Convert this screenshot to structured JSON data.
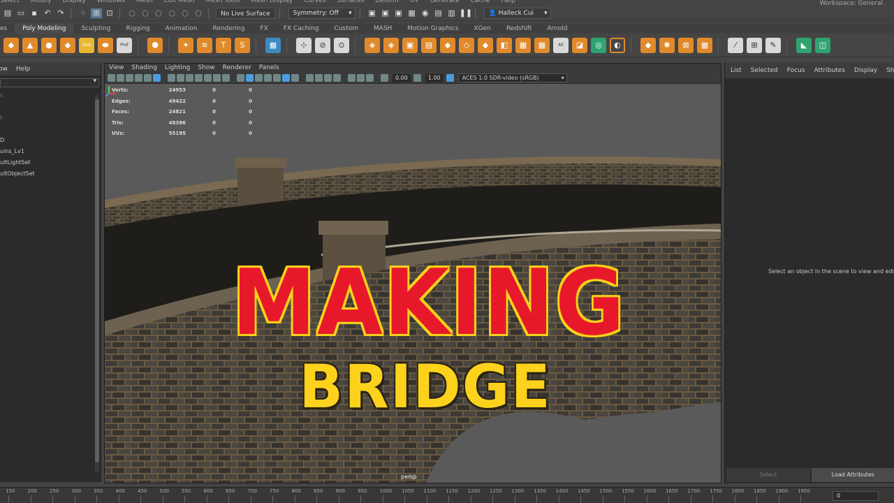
{
  "app": {
    "menubar_items": [
      "Select",
      "Modify",
      "Display",
      "Windows",
      "Mesh",
      "Edit Mesh",
      "Mesh Tools",
      "Mesh Display",
      "Curves",
      "Surfaces",
      "Deform",
      "UV",
      "Generate",
      "Cache",
      "Help"
    ],
    "workspace_label": "Workspace: General"
  },
  "status_line": {
    "live_surface": "No Live Surface",
    "symmetry": "Symmetry: Off",
    "user": "Halleck Cui"
  },
  "shelf": {
    "tabs": [
      "es",
      "Poly Modeling",
      "Sculpting",
      "Rigging",
      "Animation",
      "Rendering",
      "FX",
      "FX Caching",
      "Custom",
      "MASH",
      "Motion Graphics",
      "XGen",
      "Redshift",
      "Arnold"
    ],
    "active_tab": "Poly Modeling",
    "icon_labels": {
      "sele": "Sele",
      "pref": "Pref",
      "all": "All"
    }
  },
  "outliner": {
    "menu": [
      "ow",
      "Help"
    ],
    "items": [
      "s",
      "",
      "t",
      "",
      "D",
      "uins_Lv1",
      "ultLightSet",
      "ultObjectSet"
    ]
  },
  "viewport": {
    "menu": [
      "View",
      "Shading",
      "Lighting",
      "Show",
      "Renderer",
      "Panels"
    ],
    "exposure": "0.00",
    "gamma": "1.00",
    "color_space": "ACES 1.0 SDR-video (sRGB)",
    "camera": "persp",
    "hud": [
      {
        "label": "Verts:",
        "v1": "24953",
        "v2": "0",
        "v3": "0"
      },
      {
        "label": "Edges:",
        "v1": "49422",
        "v2": "0",
        "v3": "0"
      },
      {
        "label": "Faces:",
        "v1": "24821",
        "v2": "0",
        "v3": "0"
      },
      {
        "label": "Tris:",
        "v1": "48386",
        "v2": "0",
        "v3": "0"
      },
      {
        "label": "UVs:",
        "v1": "55195",
        "v2": "0",
        "v3": "0"
      }
    ],
    "overlay_title_line1": "MAKING",
    "overlay_title_line2": "BRIDGE"
  },
  "attribute_editor": {
    "menu": [
      "List",
      "Selected",
      "Focus",
      "Attributes",
      "Display",
      "Show"
    ],
    "message": "Select an object in the scene to view and edi",
    "select_button": "Select",
    "load_button": "Load Attributes"
  },
  "timeline": {
    "ticks": [
      "150",
      "200",
      "250",
      "300",
      "350",
      "400",
      "450",
      "500",
      "550",
      "600",
      "650",
      "700",
      "750",
      "800",
      "850",
      "900",
      "950",
      "1000",
      "1050",
      "1100",
      "1150",
      "1200",
      "1250",
      "1300",
      "1350",
      "1400",
      "1450",
      "1500",
      "1550",
      "1600",
      "1650",
      "1700",
      "1750",
      "1800",
      "1850",
      "1900",
      "1950",
      "2000"
    ],
    "current_frame": "0"
  },
  "colors": {
    "title_red": "#e8182b",
    "title_yellow": "#fdd21d",
    "accent_blue": "#4b9de0",
    "shelf_orange": "#e08a2c"
  }
}
